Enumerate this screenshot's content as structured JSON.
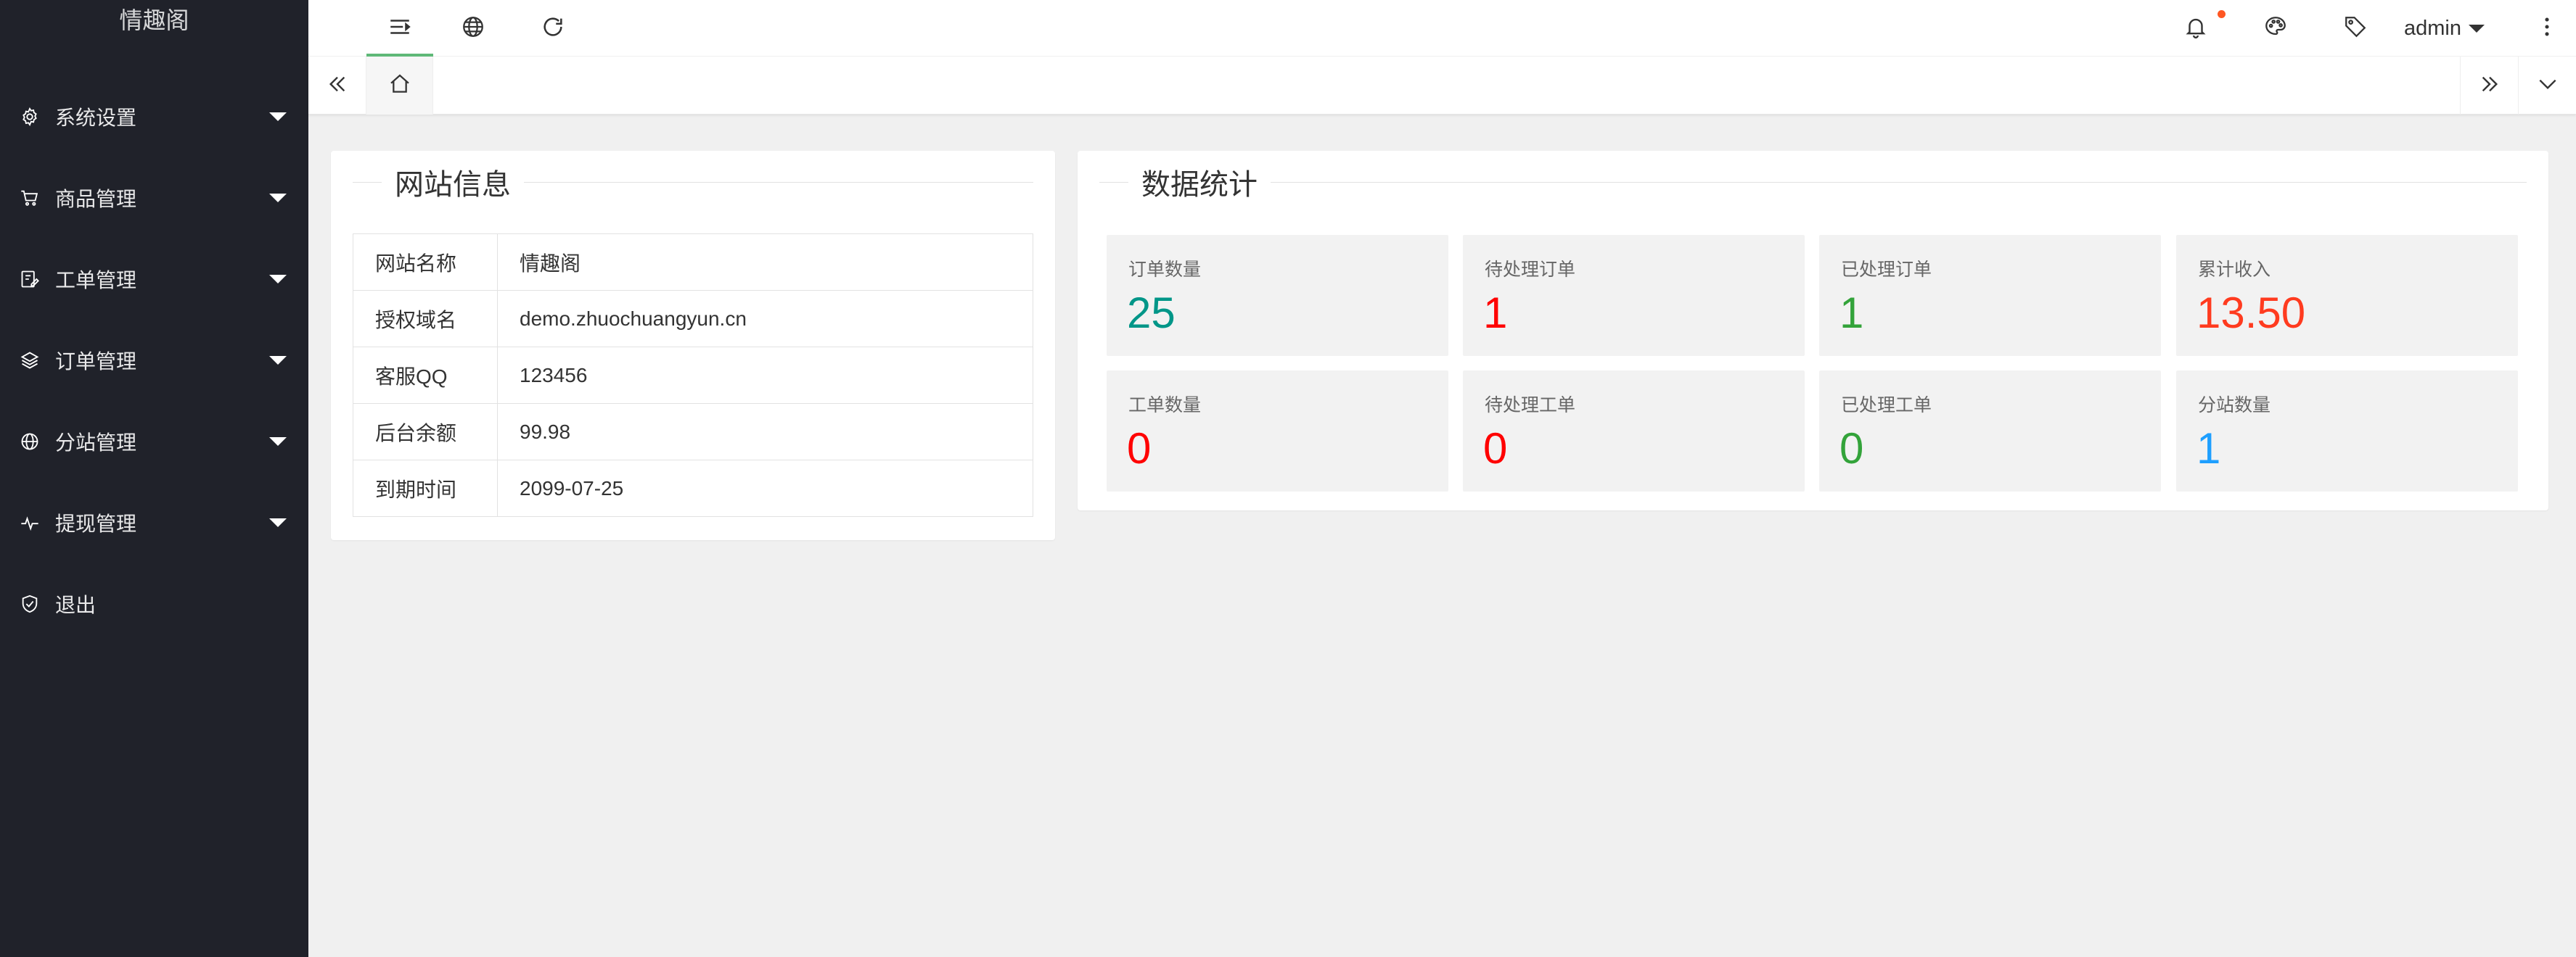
{
  "app": {
    "name": "情趣阁"
  },
  "sidebar": {
    "items": [
      {
        "label": "系统设置",
        "icon": "gear-icon"
      },
      {
        "label": "商品管理",
        "icon": "cart-icon"
      },
      {
        "label": "工单管理",
        "icon": "edit-icon"
      },
      {
        "label": "订单管理",
        "icon": "layers-icon"
      },
      {
        "label": "分站管理",
        "icon": "globe-icon"
      },
      {
        "label": "提现管理",
        "icon": "pulse-icon"
      },
      {
        "label": "退出",
        "icon": "shield-icon"
      }
    ]
  },
  "header": {
    "user": "admin",
    "icons": [
      "menu-toggle-icon",
      "globe-icon",
      "refresh-icon",
      "bell-icon",
      "theme-icon",
      "tag-icon",
      "more-vertical-icon"
    ]
  },
  "site_info": {
    "title": "网站信息",
    "rows": [
      {
        "key": "网站名称",
        "value": "情趣阁"
      },
      {
        "key": "授权域名",
        "value": "demo.zhuochuangyun.cn"
      },
      {
        "key": "客服QQ",
        "value": "123456"
      },
      {
        "key": "后台余额",
        "value": "99.98"
      },
      {
        "key": "到期时间",
        "value": "2099-07-25"
      }
    ]
  },
  "stats": {
    "title": "数据统计",
    "items": [
      {
        "label": "订单数量",
        "value": "25",
        "color": "#009688"
      },
      {
        "label": "待处理订单",
        "value": "1",
        "color": "#ff0000"
      },
      {
        "label": "已处理订单",
        "value": "1",
        "color": "#33a33a"
      },
      {
        "label": "累计收入",
        "value": "13.50",
        "color": "#ff3b1f"
      },
      {
        "label": "工单数量",
        "value": "0",
        "color": "#ff0000"
      },
      {
        "label": "待处理工单",
        "value": "0",
        "color": "#ff0000"
      },
      {
        "label": "已处理工单",
        "value": "0",
        "color": "#33a33a"
      },
      {
        "label": "分站数量",
        "value": "1",
        "color": "#1e9fff"
      }
    ]
  }
}
